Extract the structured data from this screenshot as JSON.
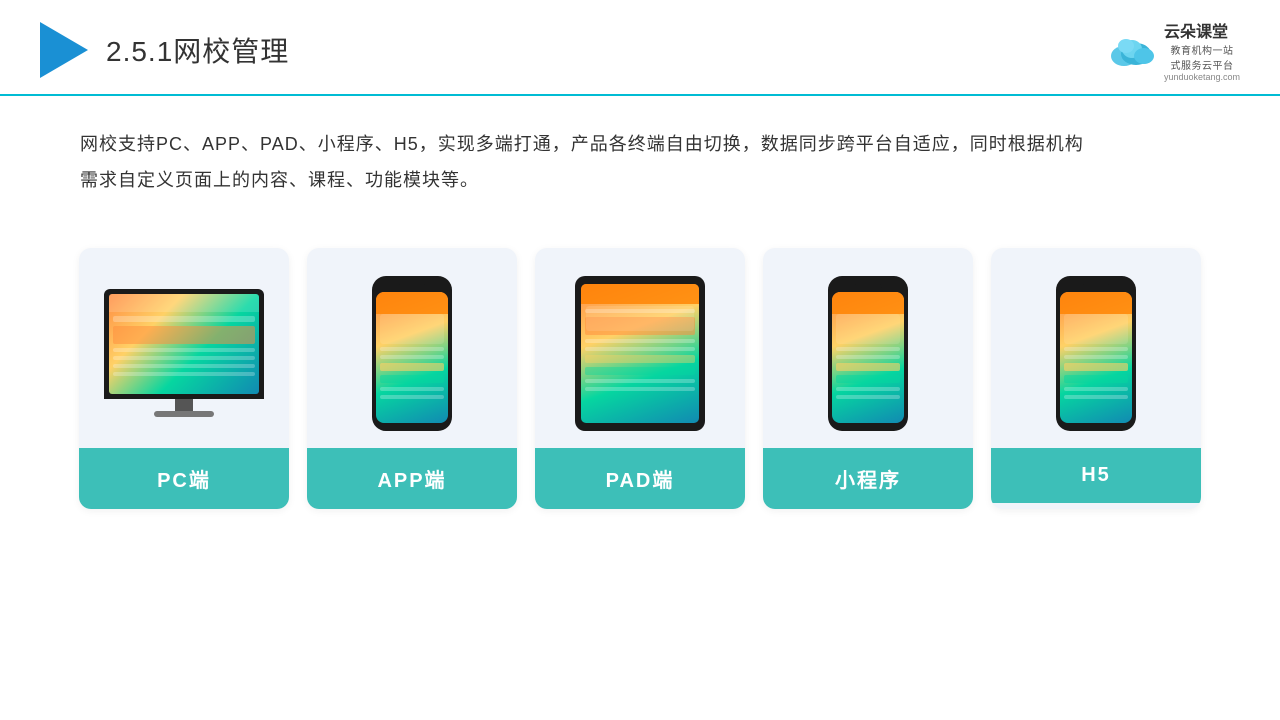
{
  "header": {
    "title_number": "2.5.1",
    "title_text": "网校管理",
    "brand": {
      "name": "云朵课堂",
      "url": "yunduoketang.com",
      "tagline": "教育机构一站\n式服务云平台"
    }
  },
  "description": {
    "text": "网校支持PC、APP、PAD、小程序、H5，实现多端打通，产品各终端自由切换，数据同步跨平台自适应，同时根据机构需求自定义页面上的内容、课程、功能模块等。"
  },
  "cards": [
    {
      "id": "pc",
      "label": "PC端",
      "type": "pc"
    },
    {
      "id": "app",
      "label": "APP端",
      "type": "phone"
    },
    {
      "id": "pad",
      "label": "PAD端",
      "type": "tablet"
    },
    {
      "id": "miniprogram",
      "label": "小程序",
      "type": "phone"
    },
    {
      "id": "h5",
      "label": "H5",
      "type": "phone"
    }
  ],
  "colors": {
    "accent": "#3dbfb8",
    "header_line": "#00bcd4",
    "arrow": "#1a90d4",
    "text_dark": "#222",
    "text_body": "#333",
    "card_bg": "#f0f4fa"
  }
}
